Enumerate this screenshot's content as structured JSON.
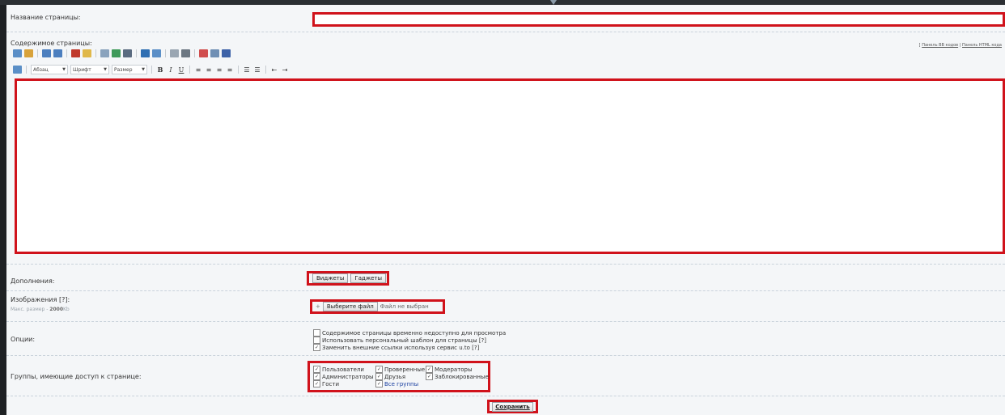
{
  "page_name": {
    "label": "Название страницы:",
    "value": ""
  },
  "content": {
    "label": "Содержимое страницы:",
    "links": {
      "bb": "Панель BB кодов",
      "sep": "|",
      "html": "Панель HTML кода"
    },
    "toolbar1_icons": [
      "find-icon",
      "replace-icon",
      "undo-icon",
      "redo-icon",
      "text-color-icon",
      "bg-color-icon",
      "link-icon",
      "image-icon",
      "unlink-icon",
      "table-icon",
      "insert-icon",
      "special-char-icon",
      "hr-icon",
      "remove-format-icon",
      "source-icon",
      "spellcheck-icon"
    ],
    "toolbar2": {
      "paragraph": "Абзац",
      "font": "Шрифт",
      "size": "Размер",
      "bold": "B",
      "italic": "I",
      "underline": "U"
    }
  },
  "addons": {
    "label": "Дополнения:",
    "widgets": "Виджеты",
    "gadgets": "Гаджеты"
  },
  "images": {
    "label": "Изображения",
    "help": "[?]",
    "max_label": "Макс. размер -",
    "max_value": "2000",
    "max_unit": "Kb",
    "choose": "Выберите файл",
    "no_file": "Файл не выбран"
  },
  "options": {
    "label": "Опции:",
    "items": [
      {
        "text": "Содержимое страницы временно недоступно для просмотра",
        "checked": false,
        "help": ""
      },
      {
        "text": "Использовать персональный шаблон для страницы",
        "checked": false,
        "help": "[?]"
      },
      {
        "text": "Заменить внешние ссылки используя сервис u.to",
        "checked": true,
        "help": "[?]"
      }
    ]
  },
  "groups": {
    "label": "Группы, имеющие доступ к странице:",
    "items": [
      {
        "text": "Пользователи",
        "checked": true
      },
      {
        "text": "Проверенные",
        "checked": true
      },
      {
        "text": "Модераторы",
        "checked": true
      },
      {
        "text": "Администраторы",
        "checked": true
      },
      {
        "text": "Друзья",
        "checked": true
      },
      {
        "text": "Заблокированные",
        "checked": true
      },
      {
        "text": "Гости",
        "checked": true
      },
      {
        "text": "Все группы",
        "checked": true
      }
    ]
  },
  "save": "Сохранить",
  "colors": {
    "highlight": "#d0121b",
    "background": "#f4f6f8",
    "frame": "#1e2124",
    "link": "#1a3fa0"
  }
}
